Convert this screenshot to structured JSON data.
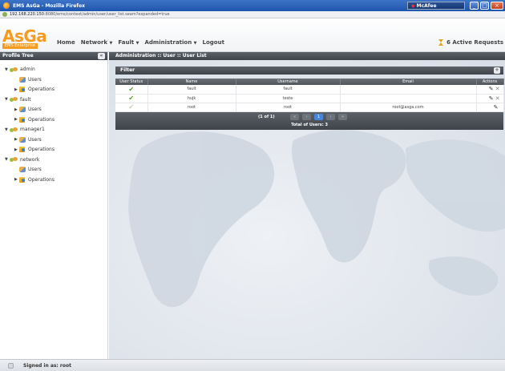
{
  "window": {
    "title": "EMS AsGa - Mozilla Firefox",
    "mcafee_label": "McAfee",
    "url_host": "192.168.220.150",
    "url_path": ":8080/ems/context/admin/user/user_list.seam?expanded=true"
  },
  "header": {
    "logo": "AsGa",
    "logo_sub": "EMS Enterprise",
    "menu": [
      {
        "label": "Home",
        "has_dropdown": false
      },
      {
        "label": "Network",
        "has_dropdown": true
      },
      {
        "label": "Fault",
        "has_dropdown": true
      },
      {
        "label": "Administration",
        "has_dropdown": true
      },
      {
        "label": "Logout",
        "has_dropdown": false
      }
    ],
    "active_requests": "6 Active Requests"
  },
  "sidebar": {
    "title": "Profile Tree",
    "collapse_label": "«",
    "nodes": [
      {
        "label": "admin",
        "type": "group",
        "twisty": "▼"
      },
      {
        "label": "Users",
        "type": "users",
        "twisty": ""
      },
      {
        "label": "Operations",
        "type": "ops",
        "twisty": "▶"
      },
      {
        "label": "fault",
        "type": "group",
        "twisty": "▼"
      },
      {
        "label": "Users",
        "type": "users",
        "twisty": "▶"
      },
      {
        "label": "Operations",
        "type": "ops",
        "twisty": "▶"
      },
      {
        "label": "manager1",
        "type": "group",
        "twisty": "▼"
      },
      {
        "label": "Users",
        "type": "users",
        "twisty": "▶"
      },
      {
        "label": "Operations",
        "type": "ops",
        "twisty": "▶"
      },
      {
        "label": "network",
        "type": "group",
        "twisty": "▼"
      },
      {
        "label": "Users",
        "type": "users",
        "twisty": ""
      },
      {
        "label": "Operations",
        "type": "ops",
        "twisty": "▶"
      }
    ]
  },
  "main": {
    "breadcrumb": "Administration :: User :: User List",
    "filter_label": "Filter",
    "filter_expand": "+",
    "table": {
      "columns": [
        "User Status",
        "Name",
        "Username",
        "Email",
        "Actions"
      ],
      "rows": [
        {
          "status": "active",
          "name": "fault",
          "username": "fault",
          "email": "",
          "deletable": true
        },
        {
          "status": "active",
          "name": "hujk",
          "username": "teste",
          "email": "",
          "deletable": true
        },
        {
          "status": "inactive",
          "name": "root",
          "username": "root",
          "email": "root@asga.com",
          "deletable": false
        }
      ]
    },
    "pager": {
      "info": "(1 of 1)",
      "buttons": [
        "«",
        "‹",
        "1",
        "›",
        "»"
      ],
      "current_page": "1",
      "total": "Total of Users: 3"
    }
  },
  "status": {
    "signed_in": "Signed in as: root"
  },
  "colors": {
    "brand": "#f39c1f",
    "header_dark": "#4a4f56",
    "active_check": "#4da024",
    "inactive_check": "#c9cfb5"
  }
}
